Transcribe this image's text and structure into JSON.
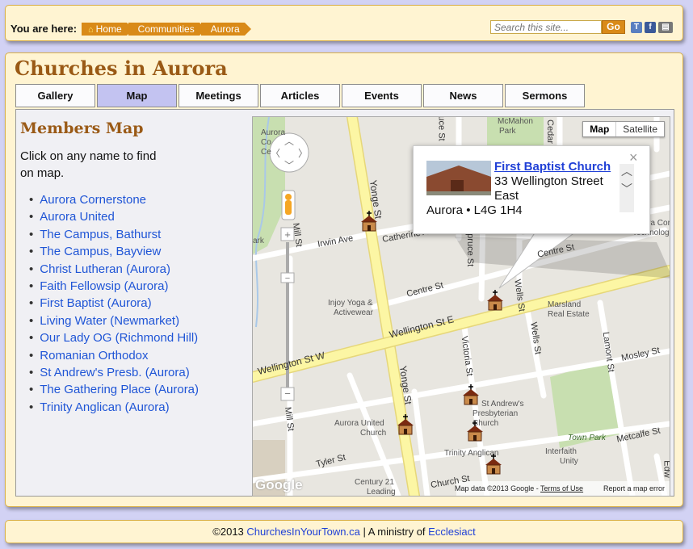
{
  "topbar": {
    "you_are_here": "You are here:",
    "breadcrumbs": [
      "Home",
      "Communities",
      "Aurora"
    ],
    "search_placeholder": "Search this site...",
    "go_label": "Go"
  },
  "page": {
    "title": "Churches in Aurora"
  },
  "tabs": [
    {
      "label": "Gallery",
      "active": false
    },
    {
      "label": "Map",
      "active": true
    },
    {
      "label": "Meetings",
      "active": false
    },
    {
      "label": "Articles",
      "active": false
    },
    {
      "label": "Events",
      "active": false
    },
    {
      "label": "News",
      "active": false
    },
    {
      "label": "Sermons",
      "active": false
    }
  ],
  "sidebar": {
    "title": "Members Map",
    "instructions": "Click on any name to find on map.",
    "churches": [
      "Aurora Cornerstone",
      "Aurora United",
      "The Campus, Bathurst",
      "The Campus, Bayview",
      "Christ Lutheran (Aurora)",
      "Faith Fellowsip (Aurora)",
      "First Baptist (Aurora)",
      "Living Water (Newmarket)",
      "Our Lady OG (Richmond Hill)",
      "Romanian Orthodox",
      "St Andrew's Presb. (Aurora)",
      "The Gathering Place (Aurora)",
      "Trinity Anglican (Aurora)"
    ]
  },
  "map": {
    "map_type_buttons": [
      "Map",
      "Satellite"
    ],
    "active_map_type": "Map",
    "popup": {
      "name": "First Baptist Church",
      "address_line1": "33 Wellington Street",
      "address_line2": "East",
      "address_line3": "Aurora • L4G 1H4"
    },
    "streets": {
      "yonge_north": "Yonge St",
      "yonge_south": "Yonge St",
      "wellington_w": "Wellington St W",
      "wellington_e": "Wellington St E",
      "irwin": "Irwin Ave",
      "catherine": "Catherine Ave",
      "centre1": "Centre St",
      "centre2": "Centre St",
      "victoria": "Victoria St",
      "wells": "Wells St",
      "wells2": "Wells St",
      "lamont": "Lamont St",
      "mosley": "Mosley St",
      "metcalfe": "Metcalfe St",
      "tyler": "Tyler St",
      "church": "Church St",
      "mill": "Mill St",
      "spruce": "Spruce St",
      "mill_top": "Mill St",
      "cedar": "Cedar",
      "juce": "uce St",
      "edw": "Edw"
    },
    "places": {
      "mcmahon_park1": "McMahon",
      "mcmahon_park2": "Park",
      "town_park": "Town Park",
      "aurora_co1": "Aurora",
      "aurora_co2": "Co",
      "aurora_co3": "Ce",
      "injoy1": "Injoy Yoga &",
      "injoy2": "Activewear",
      "marsland1": "Marsland",
      "marsland2": "Real Estate",
      "st_andrews1": "St Andrew's",
      "st_andrews2": "Presbyterian",
      "st_andrews3": "Church",
      "aurora_united1": "Aurora United",
      "aurora_united2": "Church",
      "trinity": "Trinity Anglican",
      "interfaith1": "Interfaith",
      "interfaith2": "Unity",
      "century1": "Century 21",
      "century2": "Leading",
      "aurora_cor1": "Aurora Cor",
      "aurora_cor2": "Technolog",
      "ark": "ark"
    },
    "attribution": "Map data ©2013 Google",
    "terms_label": "Terms of Use",
    "report_label": "Report a map error",
    "google_logo": "Google"
  },
  "footer": {
    "copyright": "©2013",
    "site_link": "ChurchesInYourTown.ca",
    "ministry_text": "| A ministry of",
    "ministry_link": "Ecclesiact"
  },
  "colors": {
    "page_bg": "#d2d2f4",
    "panel_bg": "#fff4d2",
    "accent": "#d98a18",
    "title": "#9a5a16",
    "link": "#1f55d6",
    "active_tab": "#c3c3f1"
  }
}
